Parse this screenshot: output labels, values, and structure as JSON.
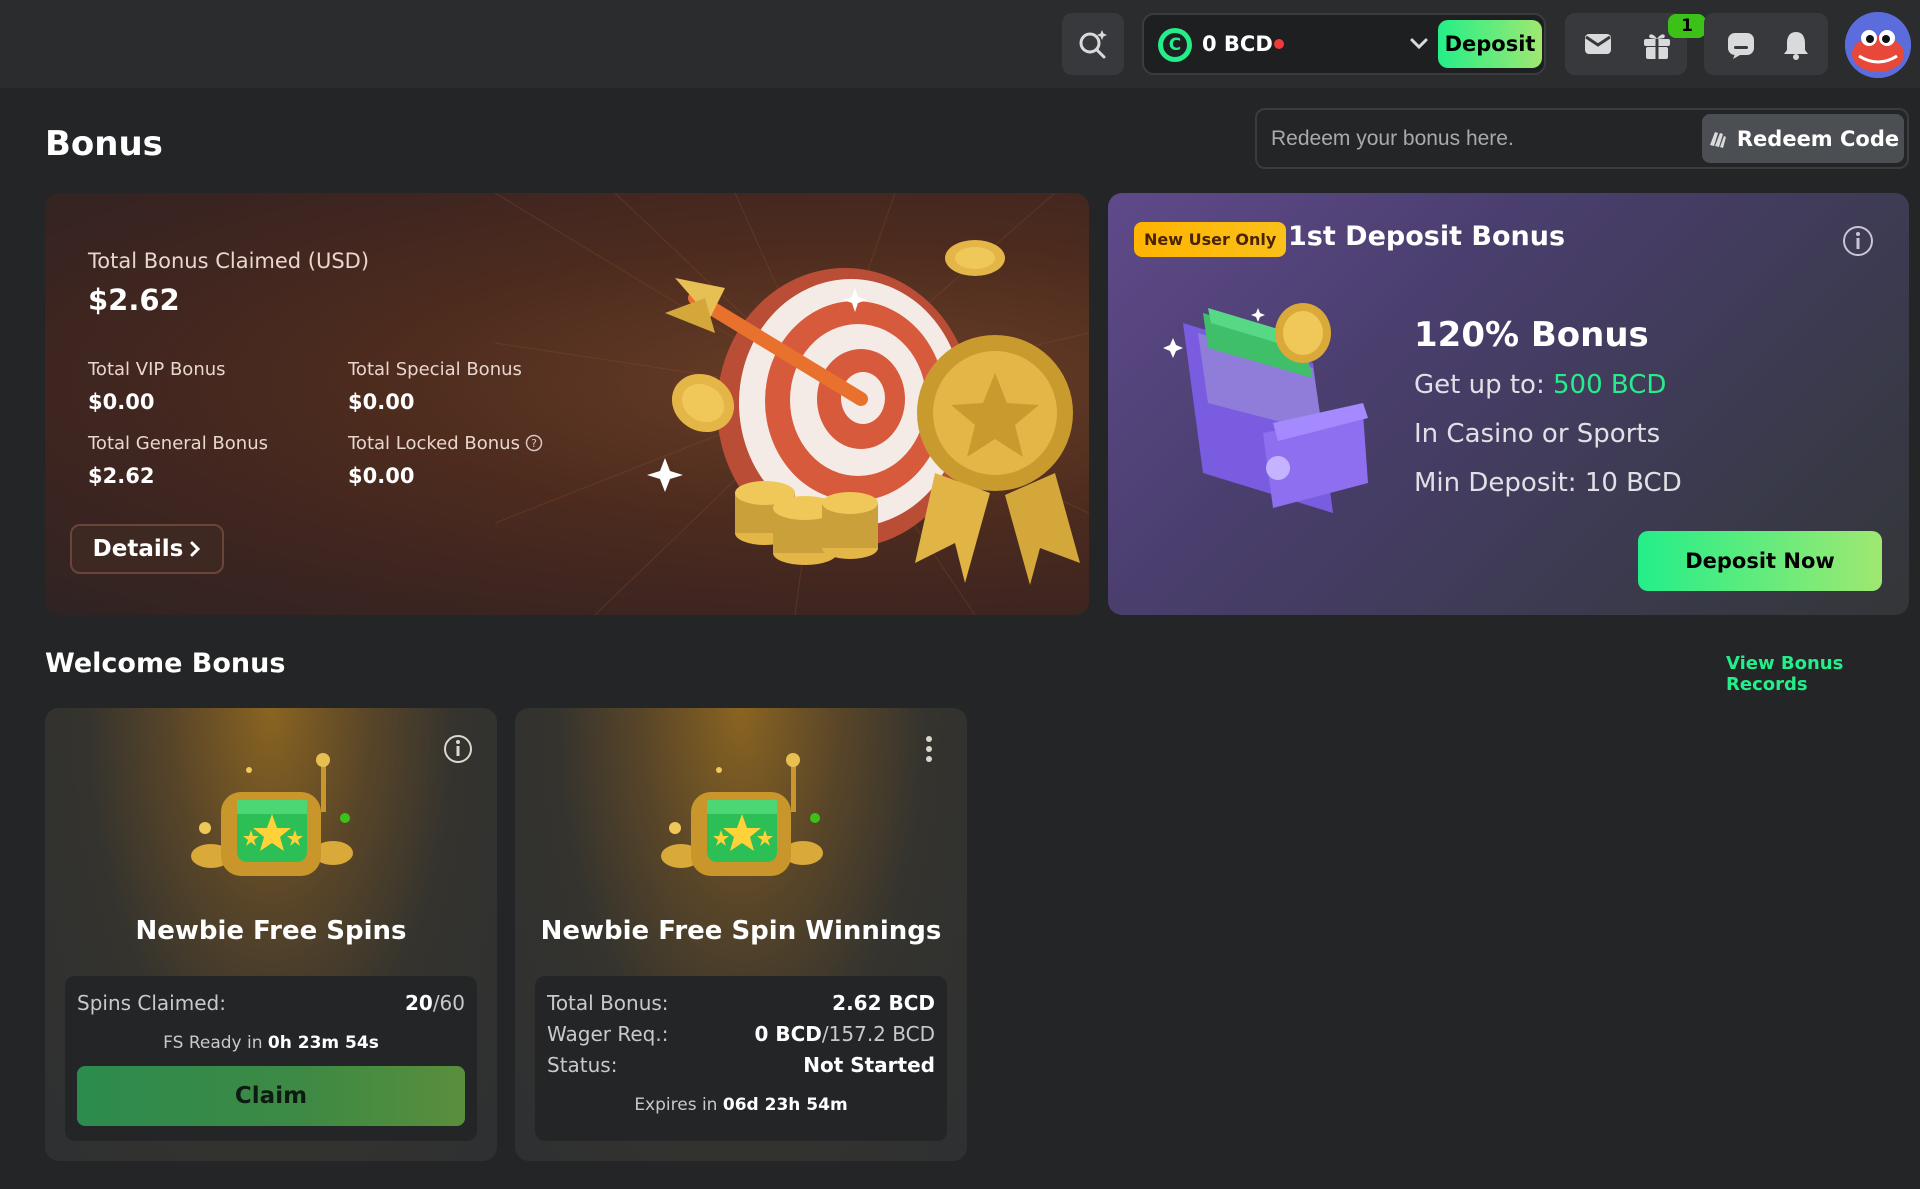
{
  "header": {
    "balance": "0 BCD",
    "deposit_label": "Deposit",
    "gift_badge": "1"
  },
  "page": {
    "title": "Bonus",
    "redeem_placeholder": "Redeem your bonus here.",
    "redeem_label": "Redeem Code"
  },
  "claimed": {
    "total_label": "Total Bonus Claimed (USD)",
    "total_value": "$2.62",
    "vip_label": "Total VIP Bonus",
    "vip_value": "$0.00",
    "special_label": "Total Special Bonus",
    "special_value": "$0.00",
    "general_label": "Total General Bonus",
    "general_value": "$2.62",
    "locked_label": "Total Locked Bonus",
    "locked_value": "$0.00",
    "details_label": "Details"
  },
  "deposit_bonus": {
    "badge": "New User Only",
    "title": "1st Deposit Bonus",
    "percent": "120% Bonus",
    "get_up_to_label": "Get up to:",
    "get_up_to_value": "500 BCD",
    "where": "In Casino or Sports",
    "min_deposit": "Min Deposit: 10 BCD",
    "button": "Deposit Now"
  },
  "welcome": {
    "title": "Welcome Bonus",
    "records_link": "View Bonus Records",
    "card1": {
      "title": "Newbie Free Spins",
      "spins_label": "Spins Claimed:",
      "spins_value": "20",
      "spins_total": "/60",
      "ready_label": "FS Ready in",
      "ready_value": "0h 23m 54s",
      "claim_label": "Claim"
    },
    "card2": {
      "title": "Newbie Free Spin Winnings",
      "total_label": "Total Bonus:",
      "total_value": "2.62 BCD",
      "wager_label": "Wager Req.:",
      "wager_value": "0 BCD",
      "wager_total": "/157.2 BCD",
      "status_label": "Status:",
      "status_value": "Not Started",
      "expires_label": "Expires in",
      "expires_value": "06d 23h 54m"
    }
  },
  "colors": {
    "accent_green": "#24ee89",
    "badge_yellow": "#ffb400",
    "background": "#232526"
  }
}
